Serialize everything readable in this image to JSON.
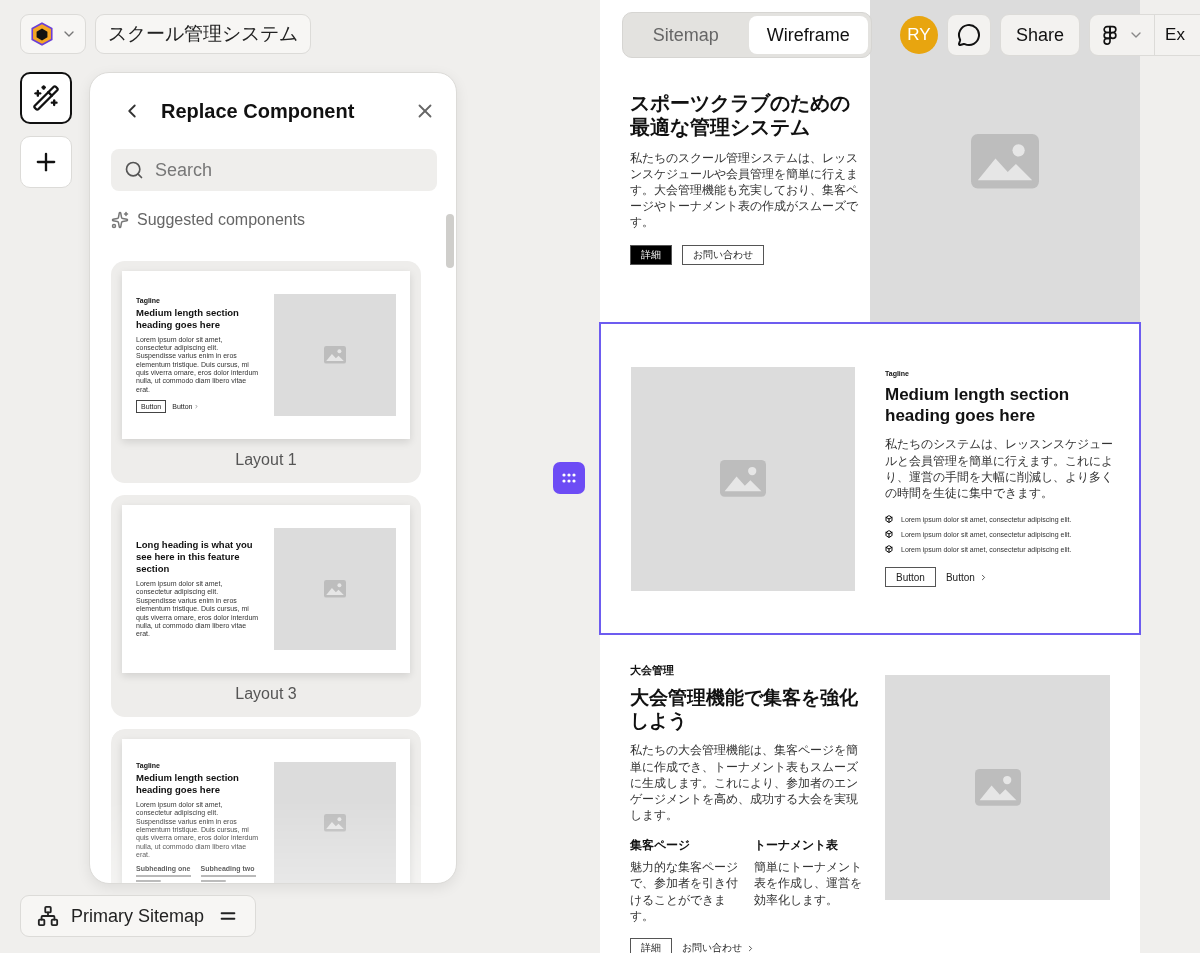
{
  "app_bar": {
    "project": "スクール管理システム"
  },
  "view_tabs": [
    {
      "label": "Sitemap",
      "selected": false
    },
    {
      "label": "Wireframe",
      "selected": true
    }
  ],
  "toolbar": {
    "avatar": "RY",
    "share": "Share",
    "export": "Ex"
  },
  "tools": [
    {
      "kind": "ai",
      "selected": true
    },
    {
      "kind": "add",
      "selected": false
    }
  ],
  "panel": {
    "title": "Replace Component",
    "search": {
      "placeholder": "Search"
    },
    "section": "Suggested components",
    "cards": [
      {
        "label": "Layout 1",
        "faded": false,
        "preview": {
          "tagline": "Tagline",
          "heading": "Medium length section heading goes here",
          "body": "Lorem ipsum dolor sit amet, consectetur adipiscing elit. Suspendisse varius enim in eros elementum tristique. Duis cursus, mi quis viverra ornare, eros dolor interdum nulla, ut commodo diam libero vitae erat.",
          "buttons": [
            {
              "label": "Button",
              "kind": "outline"
            },
            {
              "label": "Button",
              "kind": "link"
            }
          ]
        }
      },
      {
        "label": "Layout 3",
        "faded": false,
        "preview": {
          "heading": "Long heading is what you see here in this feature section",
          "body": "Lorem ipsum dolor sit amet, consectetur adipiscing elit. Suspendisse varius enim in eros elementum tristique. Duis cursus, mi quis viverra ornare, eros dolor interdum nulla, ut commodo diam libero vitae erat."
        }
      },
      {
        "faded": true,
        "preview": {
          "tagline": "Tagline",
          "heading": "Medium length section heading goes here",
          "body": "Lorem ipsum dolor sit amet, consectetur adipiscing elit. Suspendisse varius enim in eros elementum tristique. Duis cursus, mi quis viverra ornare, eros dolor interdum nulla, ut commodo diam libero vitae erat.",
          "columns": [
            {
              "title": "Subheading one"
            },
            {
              "title": "Subheading two"
            }
          ]
        }
      }
    ]
  },
  "sitemap_button": {
    "label": "Primary Sitemap"
  },
  "wireframe": {
    "sections": [
      {
        "kind": "hero",
        "selected": false,
        "heading": "スポーツクラブのための最適な管理システム",
        "body": "私たちのスクール管理システムは、レッスンスケジュールや会員管理を簡単に行えます。大会管理機能も充実しており、集客ページやトーナメント表の作成がスムーズです。",
        "buttons": [
          {
            "label": "詳細",
            "kind": "solid"
          },
          {
            "label": "お問い合わせ",
            "kind": "outline"
          }
        ]
      },
      {
        "kind": "list",
        "selected": true,
        "tagline": "Tagline",
        "heading": "Medium length section heading goes here",
        "body": "私たちのシステムは、レッスンスケジュールと会員管理を簡単に行えます。これにより、運営の手間を大幅に削減し、より多くの時間を生徒に集中できます。",
        "items": [
          "Lorem ipsum dolor sit amet, consectetur adipiscing elit.",
          "Lorem ipsum dolor sit amet, consectetur adipiscing elit.",
          "Lorem ipsum dolor sit amet, consectetur adipiscing elit."
        ],
        "buttons": [
          {
            "label": "Button",
            "kind": "outline"
          },
          {
            "label": "Button",
            "kind": "link"
          }
        ]
      },
      {
        "kind": "features",
        "selected": false,
        "tagline": "大会管理",
        "heading": "大会管理機能で集客を強化しよう",
        "body": "私たちの大会管理機能は、集客ページを簡単に作成でき、トーナメント表もスムーズに生成します。これにより、参加者のエンゲージメントを高め、成功する大会を実現します。",
        "columns": [
          {
            "title": "集客ページ",
            "body": "魅力的な集客ページで、参加者を引き付けることができます。"
          },
          {
            "title": "トーナメント表",
            "body": "簡単にトーナメント表を作成し、運営を効率化します。"
          }
        ],
        "buttons": [
          {
            "label": "詳細",
            "kind": "outline"
          },
          {
            "label": "お問い合わせ",
            "kind": "link"
          }
        ]
      }
    ]
  }
}
